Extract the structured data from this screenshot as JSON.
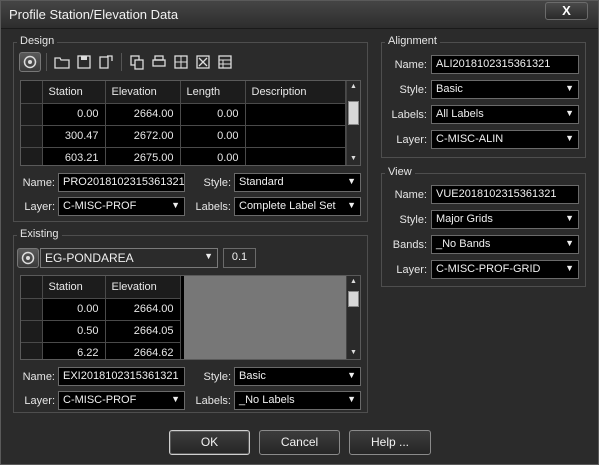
{
  "window": {
    "title": "Profile Station/Elevation Data",
    "close_glyph": "X"
  },
  "design": {
    "label": "Design",
    "table": {
      "headers": [
        "Station",
        "Elevation",
        "Length",
        "Description"
      ],
      "rows": [
        [
          "0.00",
          "2664.00",
          "0.00",
          ""
        ],
        [
          "300.47",
          "2672.00",
          "0.00",
          ""
        ],
        [
          "603.21",
          "2675.00",
          "0.00",
          ""
        ]
      ]
    },
    "name_label": "Name:",
    "name_value": "PRO2018102315361321",
    "layer_label": "Layer:",
    "layer_value": "C-MISC-PROF",
    "style_label": "Style:",
    "style_value": "Standard",
    "labels_label": "Labels:",
    "labels_value": "Complete Label Set"
  },
  "existing": {
    "label": "Existing",
    "surface_value": "EG-PONDAREA",
    "interval_value": "0.1",
    "table": {
      "headers": [
        "Station",
        "Elevation"
      ],
      "rows": [
        [
          "0.00",
          "2664.00"
        ],
        [
          "0.50",
          "2664.05"
        ],
        [
          "6.22",
          "2664.62"
        ]
      ]
    },
    "name_label": "Name:",
    "name_value": "EXI2018102315361321",
    "layer_label": "Layer:",
    "layer_value": "C-MISC-PROF",
    "style_label": "Style:",
    "style_value": "Basic",
    "labels_label": "Labels:",
    "labels_value": "_No Labels"
  },
  "alignment": {
    "label": "Alignment",
    "name_label": "Name:",
    "name_value": "ALI2018102315361321",
    "style_label": "Style:",
    "style_value": "Basic",
    "labels_label": "Labels:",
    "labels_value": "All Labels",
    "layer_label": "Layer:",
    "layer_value": "C-MISC-ALIN"
  },
  "view": {
    "label": "View",
    "name_label": "Name:",
    "name_value": "VUE2018102315361321",
    "style_label": "Style:",
    "style_value": "Major Grids",
    "bands_label": "Bands:",
    "bands_value": "_No Bands",
    "layer_label": "Layer:",
    "layer_value": "C-MISC-PROF-GRID"
  },
  "buttons": {
    "ok": "OK",
    "cancel": "Cancel",
    "help": "Help ..."
  },
  "colors": {
    "background": "#2b2b2b",
    "field": "#000000",
    "grid_gray": "#777777"
  }
}
